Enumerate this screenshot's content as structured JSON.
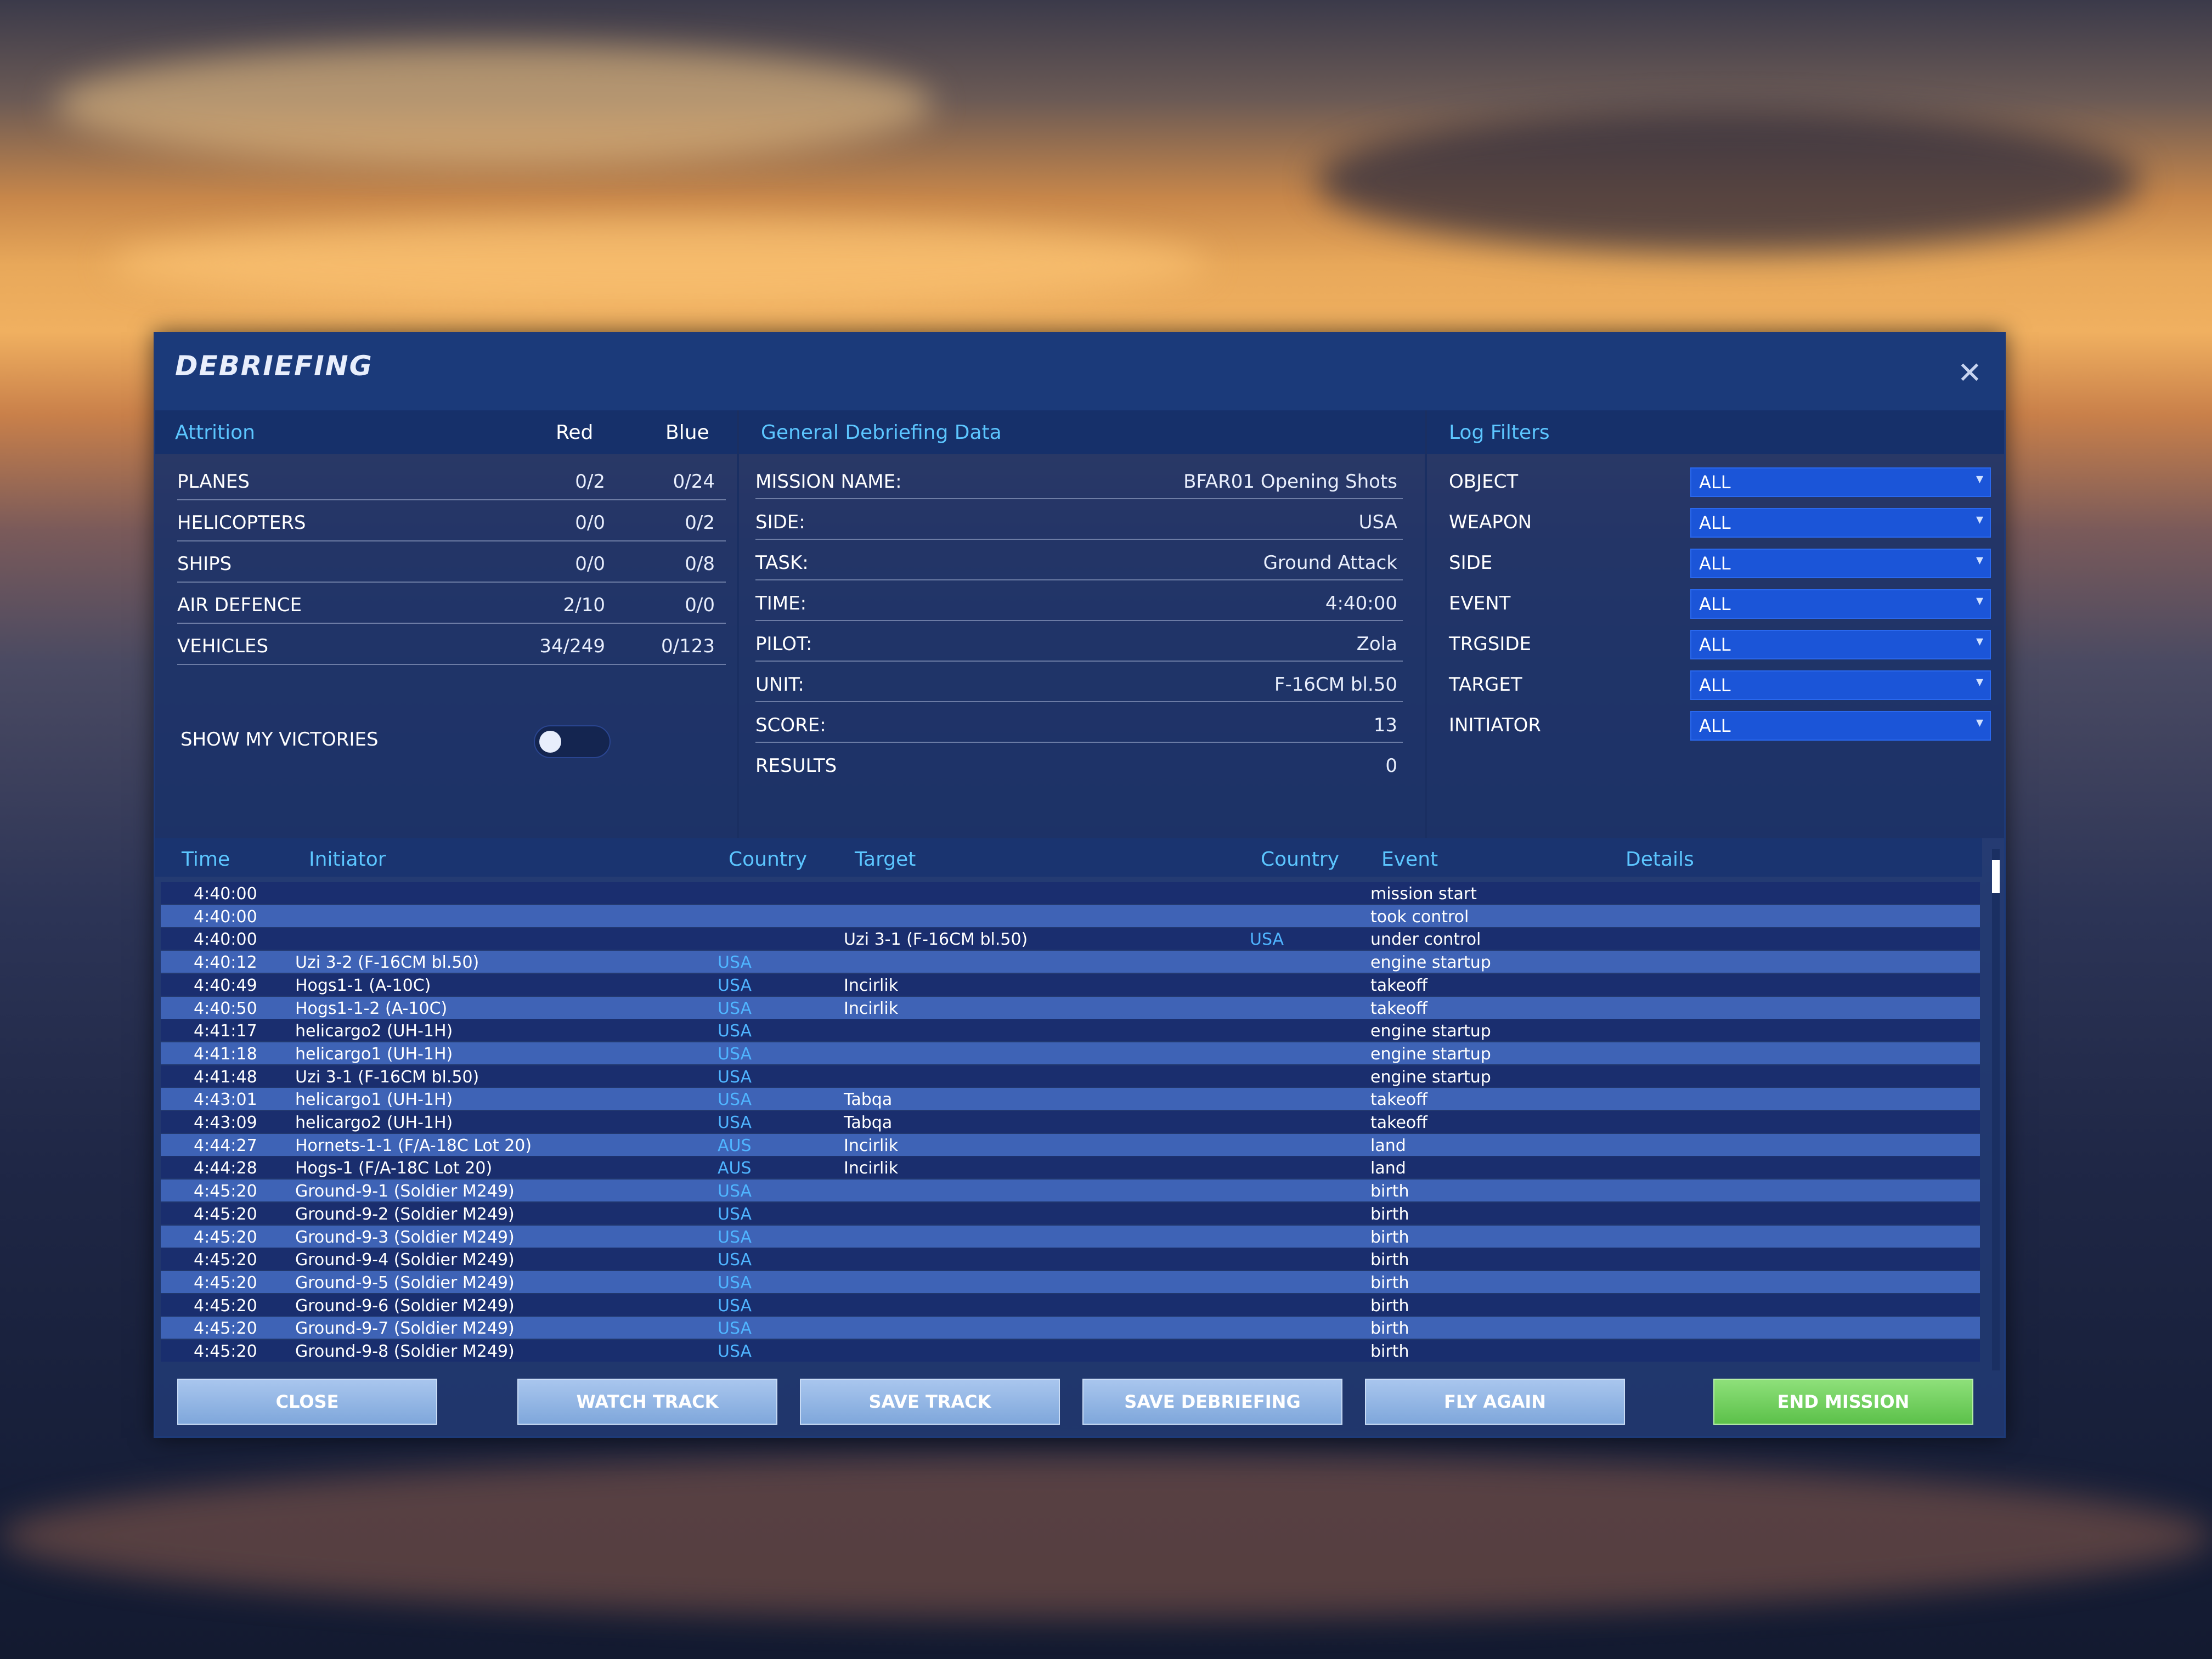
{
  "window": {
    "title": "DEBRIEFING"
  },
  "attrition": {
    "header": "Attrition",
    "col_red": "Red",
    "col_blue": "Blue",
    "rows": [
      {
        "label": "PLANES",
        "red": "0/2",
        "blue": "0/24"
      },
      {
        "label": "HELICOPTERS",
        "red": "0/0",
        "blue": "0/2"
      },
      {
        "label": "SHIPS",
        "red": "0/0",
        "blue": "0/8"
      },
      {
        "label": "AIR DEFENCE",
        "red": "2/10",
        "blue": "0/0"
      },
      {
        "label": "VEHICLES",
        "red": "34/249",
        "blue": "0/123"
      }
    ],
    "show_victories_label": "SHOW MY VICTORIES"
  },
  "general": {
    "header": "General Debriefing Data",
    "rows": [
      {
        "label": "MISSION NAME:",
        "value": "BFAR01 Opening Shots"
      },
      {
        "label": "SIDE:",
        "value": "USA"
      },
      {
        "label": "TASK:",
        "value": "Ground Attack"
      },
      {
        "label": "TIME:",
        "value": "4:40:00"
      },
      {
        "label": "PILOT:",
        "value": "Zola"
      },
      {
        "label": "UNIT:",
        "value": "F-16CM bl.50"
      },
      {
        "label": "SCORE:",
        "value": "13"
      },
      {
        "label": "RESULTS",
        "value": "0"
      }
    ]
  },
  "filters": {
    "header": "Log Filters",
    "rows": [
      {
        "label": "OBJECT",
        "value": "ALL"
      },
      {
        "label": "WEAPON",
        "value": "ALL"
      },
      {
        "label": "SIDE",
        "value": "ALL"
      },
      {
        "label": "EVENT",
        "value": "ALL"
      },
      {
        "label": "TRGSIDE",
        "value": "ALL"
      },
      {
        "label": "TARGET",
        "value": "ALL"
      },
      {
        "label": "INITIATOR",
        "value": "ALL"
      }
    ]
  },
  "log": {
    "headers": {
      "time": "Time",
      "initiator": "Initiator",
      "country": "Country",
      "target": "Target",
      "target_country": "Country",
      "event": "Event",
      "details": "Details"
    },
    "rows": [
      {
        "time": "4:40:00",
        "initiator": "",
        "country": "",
        "target": "",
        "tcountry": "",
        "event": "mission start"
      },
      {
        "time": "4:40:00",
        "initiator": "",
        "country": "",
        "target": "",
        "tcountry": "",
        "event": "took control"
      },
      {
        "time": "4:40:00",
        "initiator": "",
        "country": "",
        "target": "Uzi 3-1 (F-16CM bl.50)",
        "tcountry": "USA",
        "event": "under control"
      },
      {
        "time": "4:40:12",
        "initiator": "Uzi 3-2 (F-16CM bl.50)",
        "country": "USA",
        "target": "",
        "tcountry": "",
        "event": "engine startup"
      },
      {
        "time": "4:40:49",
        "initiator": "Hogs1-1 (A-10C)",
        "country": "USA",
        "target": "Incirlik",
        "tcountry": "",
        "event": "takeoff"
      },
      {
        "time": "4:40:50",
        "initiator": "Hogs1-1-2 (A-10C)",
        "country": "USA",
        "target": "Incirlik",
        "tcountry": "",
        "event": "takeoff"
      },
      {
        "time": "4:41:17",
        "initiator": "helicargo2 (UH-1H)",
        "country": "USA",
        "target": "",
        "tcountry": "",
        "event": "engine startup"
      },
      {
        "time": "4:41:18",
        "initiator": "helicargo1 (UH-1H)",
        "country": "USA",
        "target": "",
        "tcountry": "",
        "event": "engine startup"
      },
      {
        "time": "4:41:48",
        "initiator": "Uzi 3-1 (F-16CM bl.50)",
        "country": "USA",
        "target": "",
        "tcountry": "",
        "event": "engine startup"
      },
      {
        "time": "4:43:01",
        "initiator": "helicargo1 (UH-1H)",
        "country": "USA",
        "target": "Tabqa",
        "tcountry": "",
        "event": "takeoff"
      },
      {
        "time": "4:43:09",
        "initiator": "helicargo2 (UH-1H)",
        "country": "USA",
        "target": "Tabqa",
        "tcountry": "",
        "event": "takeoff"
      },
      {
        "time": "4:44:27",
        "initiator": "Hornets-1-1 (F/A-18C Lot 20)",
        "country": "AUS",
        "target": "Incirlik",
        "tcountry": "",
        "event": "land"
      },
      {
        "time": "4:44:28",
        "initiator": "Hogs-1 (F/A-18C Lot 20)",
        "country": "AUS",
        "target": "Incirlik",
        "tcountry": "",
        "event": "land"
      },
      {
        "time": "4:45:20",
        "initiator": "Ground-9-1 (Soldier M249)",
        "country": "USA",
        "target": "",
        "tcountry": "",
        "event": "birth"
      },
      {
        "time": "4:45:20",
        "initiator": "Ground-9-2 (Soldier M249)",
        "country": "USA",
        "target": "",
        "tcountry": "",
        "event": "birth"
      },
      {
        "time": "4:45:20",
        "initiator": "Ground-9-3 (Soldier M249)",
        "country": "USA",
        "target": "",
        "tcountry": "",
        "event": "birth"
      },
      {
        "time": "4:45:20",
        "initiator": "Ground-9-4 (Soldier M249)",
        "country": "USA",
        "target": "",
        "tcountry": "",
        "event": "birth"
      },
      {
        "time": "4:45:20",
        "initiator": "Ground-9-5 (Soldier M249)",
        "country": "USA",
        "target": "",
        "tcountry": "",
        "event": "birth"
      },
      {
        "time": "4:45:20",
        "initiator": "Ground-9-6 (Soldier M249)",
        "country": "USA",
        "target": "",
        "tcountry": "",
        "event": "birth"
      },
      {
        "time": "4:45:20",
        "initiator": "Ground-9-7 (Soldier M249)",
        "country": "USA",
        "target": "",
        "tcountry": "",
        "event": "birth"
      },
      {
        "time": "4:45:20",
        "initiator": "Ground-9-8 (Soldier M249)",
        "country": "USA",
        "target": "",
        "tcountry": "",
        "event": "birth"
      }
    ]
  },
  "buttons": {
    "close": "CLOSE",
    "watch_track": "WATCH TRACK",
    "save_track": "SAVE TRACK",
    "save_debriefing": "SAVE DEBRIEFING",
    "fly_again": "FLY AGAIN",
    "end_mission": "END MISSION"
  },
  "icons": {
    "close": "close-icon",
    "dropdown": "chevron-down-icon"
  },
  "colors": {
    "accent": "#5cc6ff",
    "country": "#4fb4ff",
    "end_button": "#6fd15a"
  }
}
